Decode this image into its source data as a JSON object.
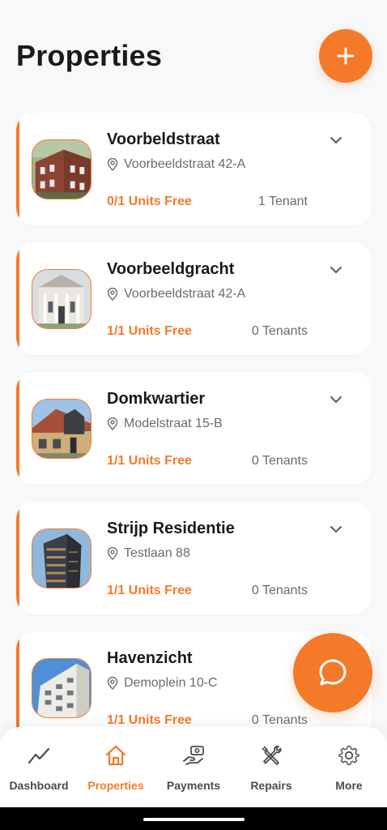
{
  "header": {
    "title": "Properties",
    "add_icon": "plus-icon"
  },
  "colors": {
    "accent": "#f47a2a",
    "text": "#1a1a1a",
    "muted": "#6b6b70",
    "background": "#f7f8fa"
  },
  "properties": [
    {
      "name": "Voorbeldstraat",
      "address": "Voorbeeldstraat 42-A",
      "units": "0/1 Units Free",
      "tenants": "1 Tenant"
    },
    {
      "name": "Voorbeeldgracht",
      "address": "Voorbeeldstraat 42-A",
      "units": "1/1 Units Free",
      "tenants": "0 Tenants"
    },
    {
      "name": "Domkwartier",
      "address": "Modelstraat 15-B",
      "units": "1/1 Units Free",
      "tenants": "0 Tenants"
    },
    {
      "name": "Strijp Residentie",
      "address": "Testlaan 88",
      "units": "1/1 Units Free",
      "tenants": "0 Tenants"
    },
    {
      "name": "Havenzicht",
      "address": "Demoplein 10-C",
      "units": "1/1 Units Free",
      "tenants": "0 Tenants"
    }
  ],
  "tabs": [
    {
      "label": "Dashboard",
      "icon": "chart-line-icon",
      "active": false
    },
    {
      "label": "Properties",
      "icon": "home-icon",
      "active": true
    },
    {
      "label": "Payments",
      "icon": "hand-money-icon",
      "active": false
    },
    {
      "label": "Repairs",
      "icon": "tools-icon",
      "active": false
    },
    {
      "label": "More",
      "icon": "gear-icon",
      "active": false
    }
  ],
  "chat": {
    "icon": "chat-bubble-icon"
  }
}
